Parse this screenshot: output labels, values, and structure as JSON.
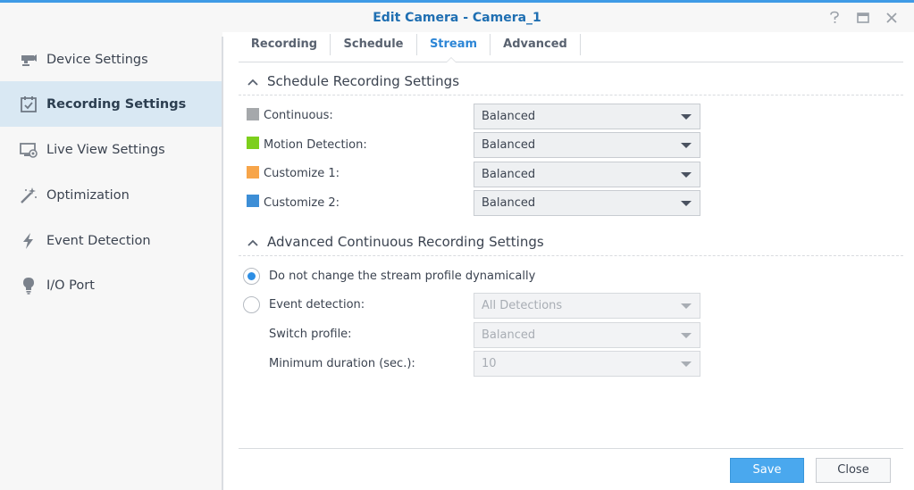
{
  "window": {
    "title": "Edit Camera - Camera_1",
    "accent_color": "#3f9be6",
    "controls": [
      "help-icon",
      "maximize-icon",
      "close-icon"
    ]
  },
  "sidebar": {
    "items": [
      {
        "label": "Device Settings",
        "icon": "camera-icon",
        "active": false
      },
      {
        "label": "Recording Settings",
        "icon": "calendar-check-icon",
        "active": true
      },
      {
        "label": "Live View Settings",
        "icon": "monitor-icon",
        "active": false
      },
      {
        "label": "Optimization",
        "icon": "magic-wand-icon",
        "active": false
      },
      {
        "label": "Event Detection",
        "icon": "lightning-icon",
        "active": false
      },
      {
        "label": "I/O Port",
        "icon": "bulb-icon",
        "active": false
      }
    ]
  },
  "tabs": [
    {
      "label": "Recording",
      "active": false
    },
    {
      "label": "Schedule",
      "active": false
    },
    {
      "label": "Stream",
      "active": true
    },
    {
      "label": "Advanced",
      "active": false
    }
  ],
  "schedule_section": {
    "title": "Schedule Recording Settings",
    "rows": [
      {
        "label": "Continuous:",
        "color": "#a5a8ab",
        "value": "Balanced"
      },
      {
        "label": "Motion Detection:",
        "color": "#7dcf1c",
        "value": "Balanced"
      },
      {
        "label": "Customize 1:",
        "color": "#f7a54a",
        "value": "Balanced"
      },
      {
        "label": "Customize 2:",
        "color": "#3d8ed6",
        "value": "Balanced"
      }
    ]
  },
  "advanced_section": {
    "title": "Advanced Continuous Recording Settings",
    "radio_no_change": {
      "label": "Do not change the stream profile dynamically",
      "selected": true
    },
    "radio_event": {
      "label": "Event detection:",
      "selected": false,
      "value": "All Detections"
    },
    "switch_profile": {
      "label": "Switch profile:",
      "value": "Balanced"
    },
    "min_duration": {
      "label": "Minimum duration (sec.):",
      "value": "10"
    }
  },
  "buttons": {
    "save": "Save",
    "close": "Close"
  }
}
